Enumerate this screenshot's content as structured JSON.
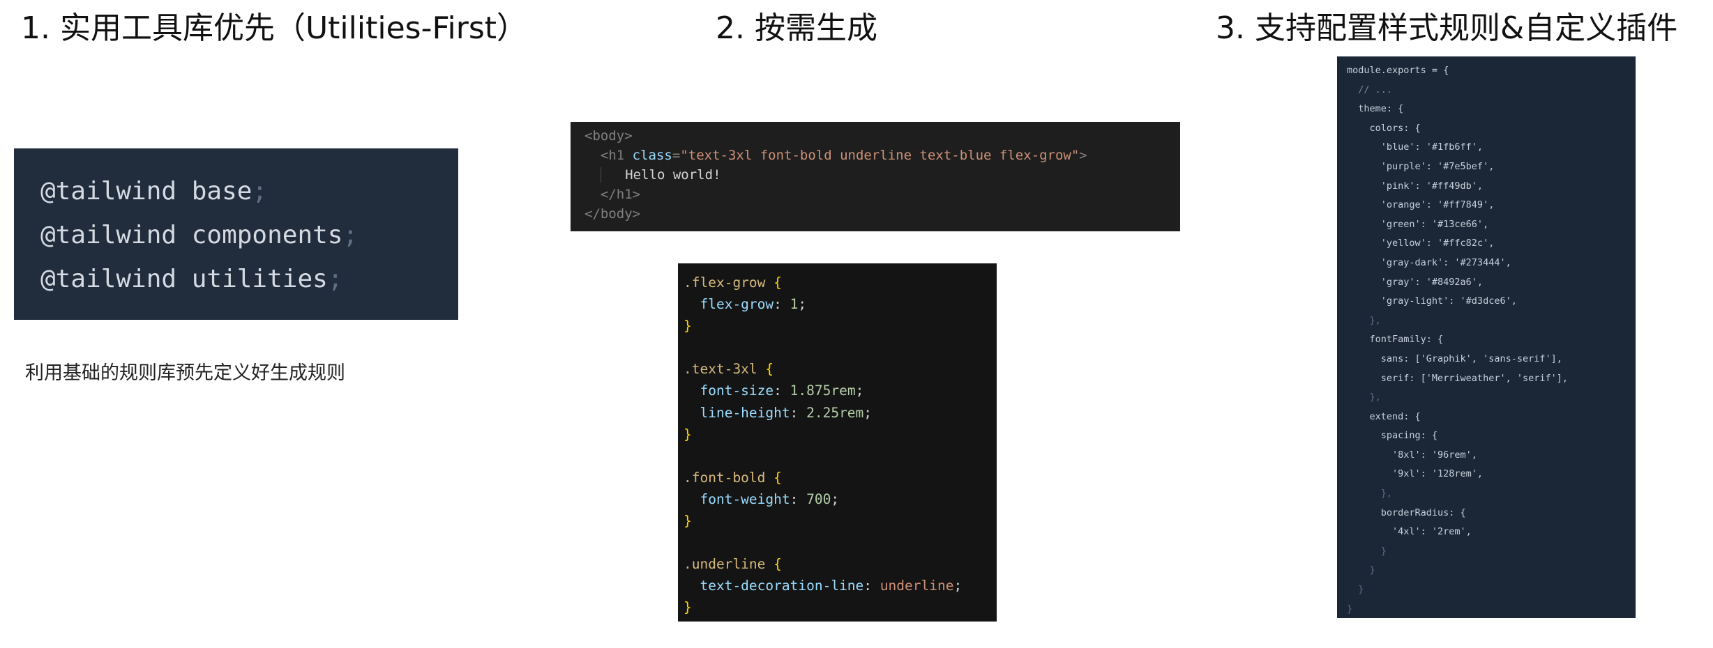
{
  "headings": {
    "one": "1. 实用工具库优先（Utilities-First）",
    "two": "2. 按需生成",
    "three": "3. 支持配置样式规则&自定义插件"
  },
  "panel1": {
    "lines": [
      "@tailwind base",
      "@tailwind components",
      "@tailwind utilities"
    ],
    "terminator": ";"
  },
  "caption": "利用基础的规则库预先定义好生成规则",
  "panel2": {
    "body_open": "<body>",
    "h1_open_start": "<h1",
    "h1_attr": "class",
    "h1_value": "\"text-3xl font-bold underline text-blue flex-grow\"",
    "h1_open_end": ">",
    "text": "Hello world!",
    "h1_close": "</h1>",
    "body_close": "</body>"
  },
  "panel3": {
    "rules": [
      {
        "selector": ".flex-grow",
        "decls": [
          {
            "prop": "flex-grow",
            "value": "1"
          }
        ]
      },
      {
        "selector": ".text-3xl",
        "decls": [
          {
            "prop": "font-size",
            "value": "1.875rem"
          },
          {
            "prop": "line-height",
            "value": "2.25rem"
          }
        ]
      },
      {
        "selector": ".font-bold",
        "decls": [
          {
            "prop": "font-weight",
            "value": "700"
          }
        ]
      },
      {
        "selector": ".underline",
        "decls": [
          {
            "prop": "text-decoration-line",
            "value": "underline"
          }
        ]
      }
    ]
  },
  "panel4": {
    "lines": [
      "module.exports = {",
      "  // ...",
      "  theme: {",
      "    colors: {",
      "      'blue': '#1fb6ff',",
      "      'purple': '#7e5bef',",
      "      'pink': '#ff49db',",
      "      'orange': '#ff7849',",
      "      'green': '#13ce66',",
      "      'yellow': '#ffc82c',",
      "      'gray-dark': '#273444',",
      "      'gray': '#8492a6',",
      "      'gray-light': '#d3dce6',",
      "    },",
      "    fontFamily: {",
      "      sans: ['Graphik', 'sans-serif'],",
      "      serif: ['Merriweather', 'serif'],",
      "    },",
      "    extend: {",
      "      spacing: {",
      "        '8xl': '96rem',",
      "        '9xl': '128rem',",
      "      },",
      "      borderRadius: {",
      "        '4xl': '2rem',",
      "      }",
      "    }",
      "  }",
      "}"
    ]
  }
}
